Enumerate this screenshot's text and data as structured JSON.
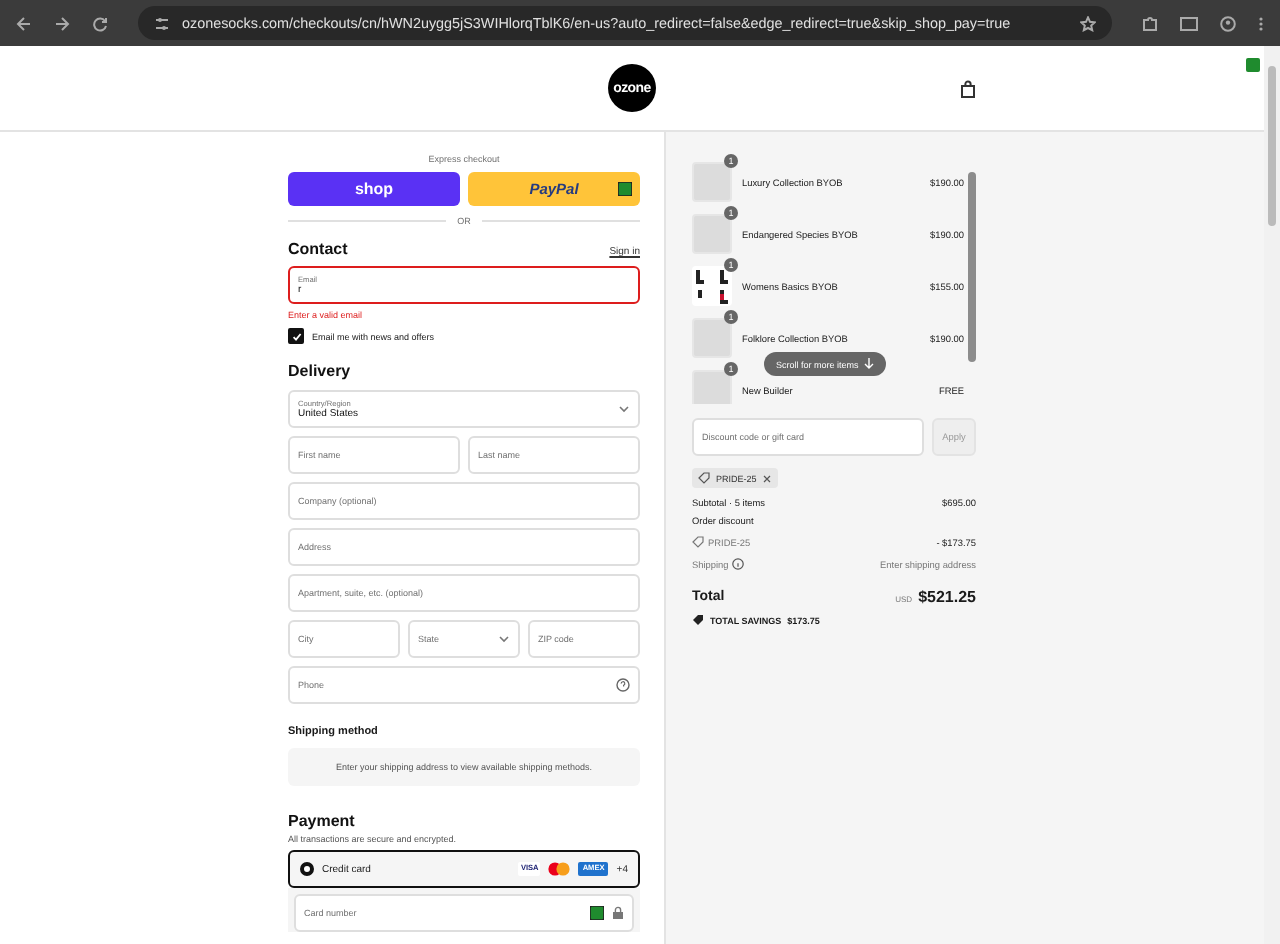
{
  "browser": {
    "url": "ozonesocks.com/checkouts/cn/hWN2uygg5jS3WIHlorqTblK6/en-us?auto_redirect=false&edge_redirect=true&skip_shop_pay=true"
  },
  "header": {
    "logo": "ozone"
  },
  "express": {
    "label": "Express checkout",
    "divider": "OR",
    "buttons": [
      {
        "kind": "shop",
        "label": "shop"
      },
      {
        "kind": "paypal",
        "label": "PayPal"
      }
    ]
  },
  "contact": {
    "heading": "Contact",
    "sign_in": "Sign in",
    "email": {
      "label": "Email",
      "value": "r",
      "invalid": true,
      "error": "Enter a valid email"
    },
    "newsletter": {
      "label": "Email me with news and offers",
      "checked": true
    }
  },
  "delivery": {
    "heading": "Delivery",
    "rows": [
      [
        {
          "kind": "select",
          "label": "Country/Region",
          "value": "United States"
        }
      ],
      [
        {
          "kind": "text",
          "placeholder": "First name"
        },
        {
          "kind": "text",
          "placeholder": "Last name"
        }
      ],
      [
        {
          "kind": "text",
          "placeholder": "Company (optional)"
        }
      ],
      [
        {
          "kind": "text",
          "placeholder": "Address"
        }
      ],
      [
        {
          "kind": "text",
          "placeholder": "Apartment, suite, etc. (optional)"
        }
      ],
      [
        {
          "kind": "text",
          "placeholder": "City"
        },
        {
          "kind": "select",
          "placeholder": "State"
        },
        {
          "kind": "text",
          "placeholder": "ZIP code"
        }
      ],
      [
        {
          "kind": "help",
          "placeholder": "Phone"
        }
      ]
    ]
  },
  "shipping_method": {
    "heading": "Shipping method",
    "message": "Enter your shipping address to view available shipping methods."
  },
  "payment": {
    "heading": "Payment",
    "note": "All transactions are secure and encrypted.",
    "methods": [
      {
        "label": "Credit card",
        "selected": true,
        "more": "+4",
        "cards": [
          {
            "kind": "visa",
            "label": "VISA"
          },
          {
            "kind": "mastercard"
          },
          {
            "kind": "amex",
            "label": "AMEX"
          }
        ]
      }
    ],
    "card_field": {
      "placeholder": "Card number"
    }
  },
  "cart": {
    "items": [
      {
        "name": "Luxury Collection BYOB",
        "price": "$190.00",
        "quantity": "1",
        "kind": "placeholder"
      },
      {
        "name": "Endangered Species BYOB",
        "price": "$190.00",
        "quantity": "1",
        "kind": "placeholder"
      },
      {
        "name": "Womens Basics BYOB",
        "price": "$155.00",
        "quantity": "1",
        "kind": "photo"
      },
      {
        "name": "Folklore Collection BYOB",
        "price": "$190.00",
        "quantity": "1",
        "kind": "placeholder"
      },
      {
        "name": "New Builder",
        "price": "FREE",
        "quantity": "1",
        "kind": "placeholder"
      }
    ],
    "scroll_hint": "Scroll for more items",
    "discount": {
      "placeholder": "Discount code or gift card",
      "apply": "Apply"
    },
    "codes": [
      {
        "code": "PRIDE-25"
      }
    ],
    "summary": {
      "subtotal_label": "Subtotal · 5 items",
      "subtotal": "$695.00",
      "discount_label": "Order discount",
      "discount_code": "PRIDE-25",
      "discount_amount": "- $173.75",
      "shipping_label": "Shipping",
      "shipping_value": "Enter shipping address",
      "total_label": "Total",
      "currency": "USD",
      "total": "$521.25",
      "savings_label": "TOTAL SAVINGS",
      "savings": "$173.75"
    }
  }
}
